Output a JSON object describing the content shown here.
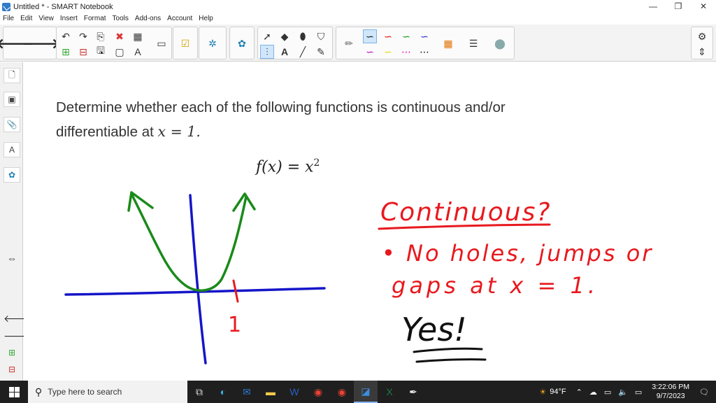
{
  "window": {
    "title": "Untitled * - SMART Notebook",
    "minimize": "—",
    "restore": "❐",
    "close": "✕"
  },
  "menu": [
    "File",
    "Edit",
    "View",
    "Insert",
    "Format",
    "Tools",
    "Add-ons",
    "Account",
    "Help"
  ],
  "page": {
    "question_line1": "Determine whether each of the following functions is continuous and/or",
    "question_line2_prefix": "differentiable at ",
    "question_line2_math": "x = 1.",
    "formula_lhs": "f(x) = x",
    "formula_exp": "2"
  },
  "ink": {
    "tick_label": "1",
    "heading": "Continuous?",
    "bullet_line1": "• No holes, jumps or",
    "bullet_line2": "gaps at x = 1.",
    "answer": "Yes!",
    "colors": {
      "red": "#e8191e",
      "green": "#1a8a1a",
      "blue": "#1515c9"
    }
  },
  "taskbar": {
    "search_placeholder": "Type here to search",
    "weather": "94°F",
    "time": "3:22:06 PM",
    "date": "9/7/2023"
  }
}
